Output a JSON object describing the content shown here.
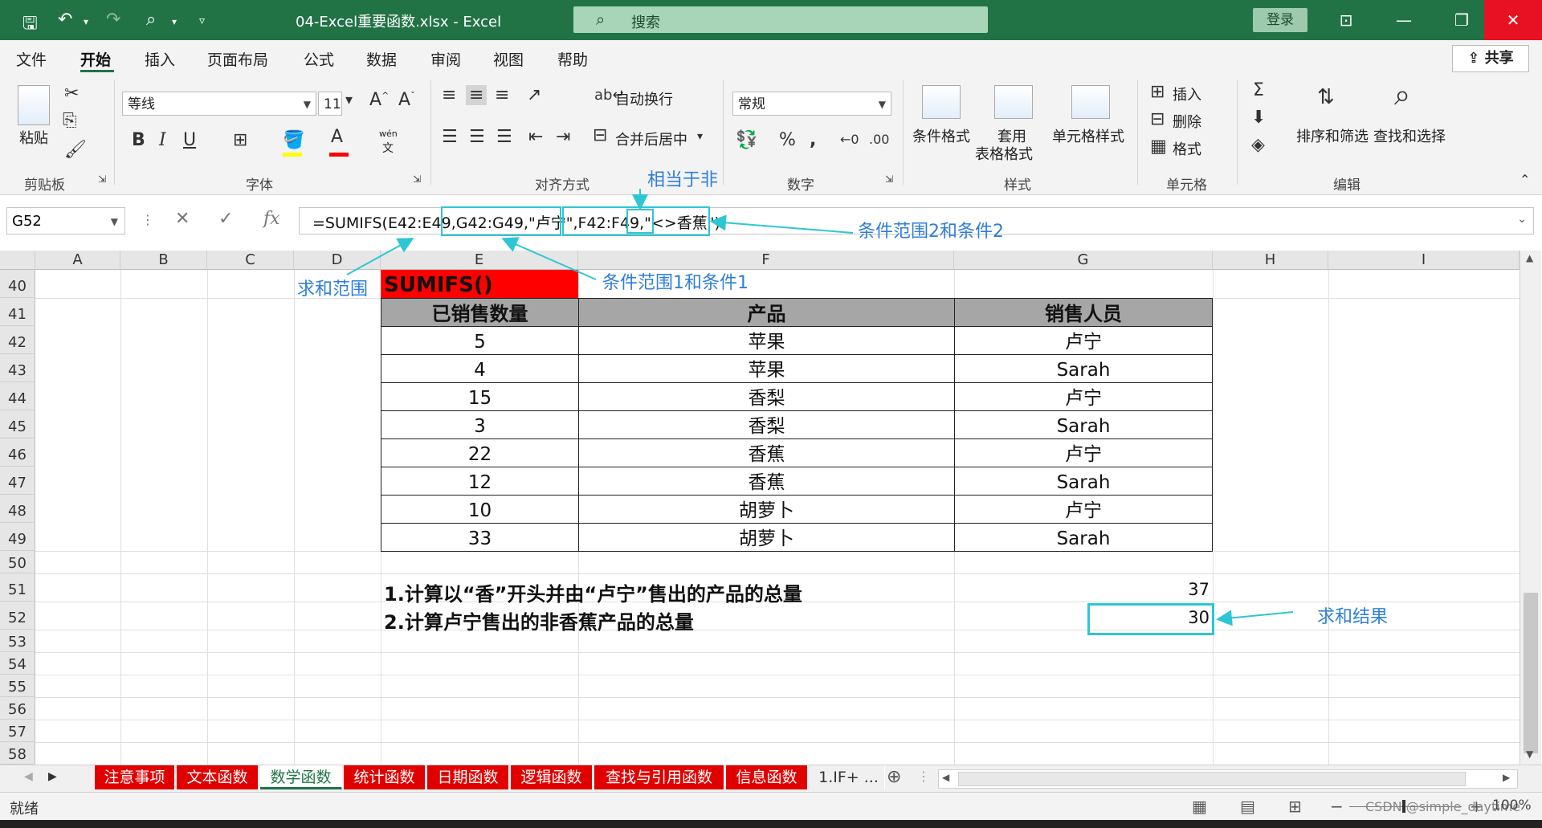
{
  "titlebar": {
    "file_title": "04-Excel重要函数.xlsx  -  Excel",
    "search_placeholder": "搜索",
    "login": "登录"
  },
  "menu": [
    "文件",
    "开始",
    "插入",
    "页面布局",
    "公式",
    "数据",
    "审阅",
    "视图",
    "帮助"
  ],
  "share_label": "共享",
  "ribbon": {
    "clipboard": {
      "paste": "粘贴",
      "label": "剪贴板"
    },
    "font": {
      "name": "等线",
      "size": "11",
      "label": "字体",
      "wen": "wén",
      "wen2": "文"
    },
    "alignment": {
      "wrap": "自动换行",
      "merge": "合并后居中",
      "label": "对齐方式"
    },
    "number": {
      "format": "常规",
      "label": "数字"
    },
    "styles": {
      "conditional": "条件格式",
      "table_fmt_1": "套用",
      "table_fmt_2": "表格格式",
      "cell_styles": "单元格样式",
      "label": "样式"
    },
    "cells": {
      "insert": "插入",
      "delete": "删除",
      "format": "格式",
      "label": "单元格"
    },
    "editing": {
      "sort_filter": "排序和筛选",
      "find_select": "查找和选择",
      "label": "编辑"
    }
  },
  "formula_bar": {
    "name_box": "G52",
    "fx": "fx",
    "formula": "=SUMIFS(E42:E49,G42:G49,\"卢宁\",F42:F49,\"<>香蕉\")"
  },
  "columns": [
    "A",
    "B",
    "C",
    "D",
    "E",
    "F",
    "G",
    "H",
    "I"
  ],
  "rows": [
    "40",
    "41",
    "42",
    "43",
    "44",
    "45",
    "46",
    "47",
    "48",
    "49",
    "50",
    "51",
    "52",
    "53",
    "54",
    "55",
    "56",
    "57",
    "58"
  ],
  "sheet": {
    "title": "SUMIFS()",
    "headers": [
      "已销售数量",
      "产品",
      "销售人员"
    ],
    "data": [
      [
        "5",
        "苹果",
        "卢宁"
      ],
      [
        "4",
        "苹果",
        "Sarah"
      ],
      [
        "15",
        "香梨",
        "卢宁"
      ],
      [
        "3",
        "香梨",
        "Sarah"
      ],
      [
        "22",
        "香蕉",
        "卢宁"
      ],
      [
        "12",
        "香蕉",
        "Sarah"
      ],
      [
        "10",
        "胡萝卜",
        "卢宁"
      ],
      [
        "33",
        "胡萝卜",
        "Sarah"
      ]
    ],
    "q1": "1.计算以“香”开头并由“卢宁”售出的产品的总量",
    "q2": "2.计算卢宁售出的非香蕉产品的总量",
    "a1": "37",
    "a2": "30"
  },
  "annotations": {
    "not_equal": "相当于非",
    "cond2": "条件范围2和条件2",
    "sum_range": "求和范围",
    "cond1": "条件范围1和条件1",
    "result": "求和结果"
  },
  "sheet_tabs": [
    "注意事项",
    "文本函数",
    "数学函数",
    "统计函数",
    "日期函数",
    "逻辑函数",
    "查找与引用函数",
    "信息函数",
    "1.IF+ ..."
  ],
  "status": {
    "ready": "就绪",
    "watermark": "CSDN @simple_daytime",
    "zoom": "100%"
  },
  "colors": {
    "excel_green": "#217346",
    "title_red": "#ff0000",
    "annotation_cyan": "#2dc6d4",
    "annotation_text": "#2f7fd8"
  }
}
